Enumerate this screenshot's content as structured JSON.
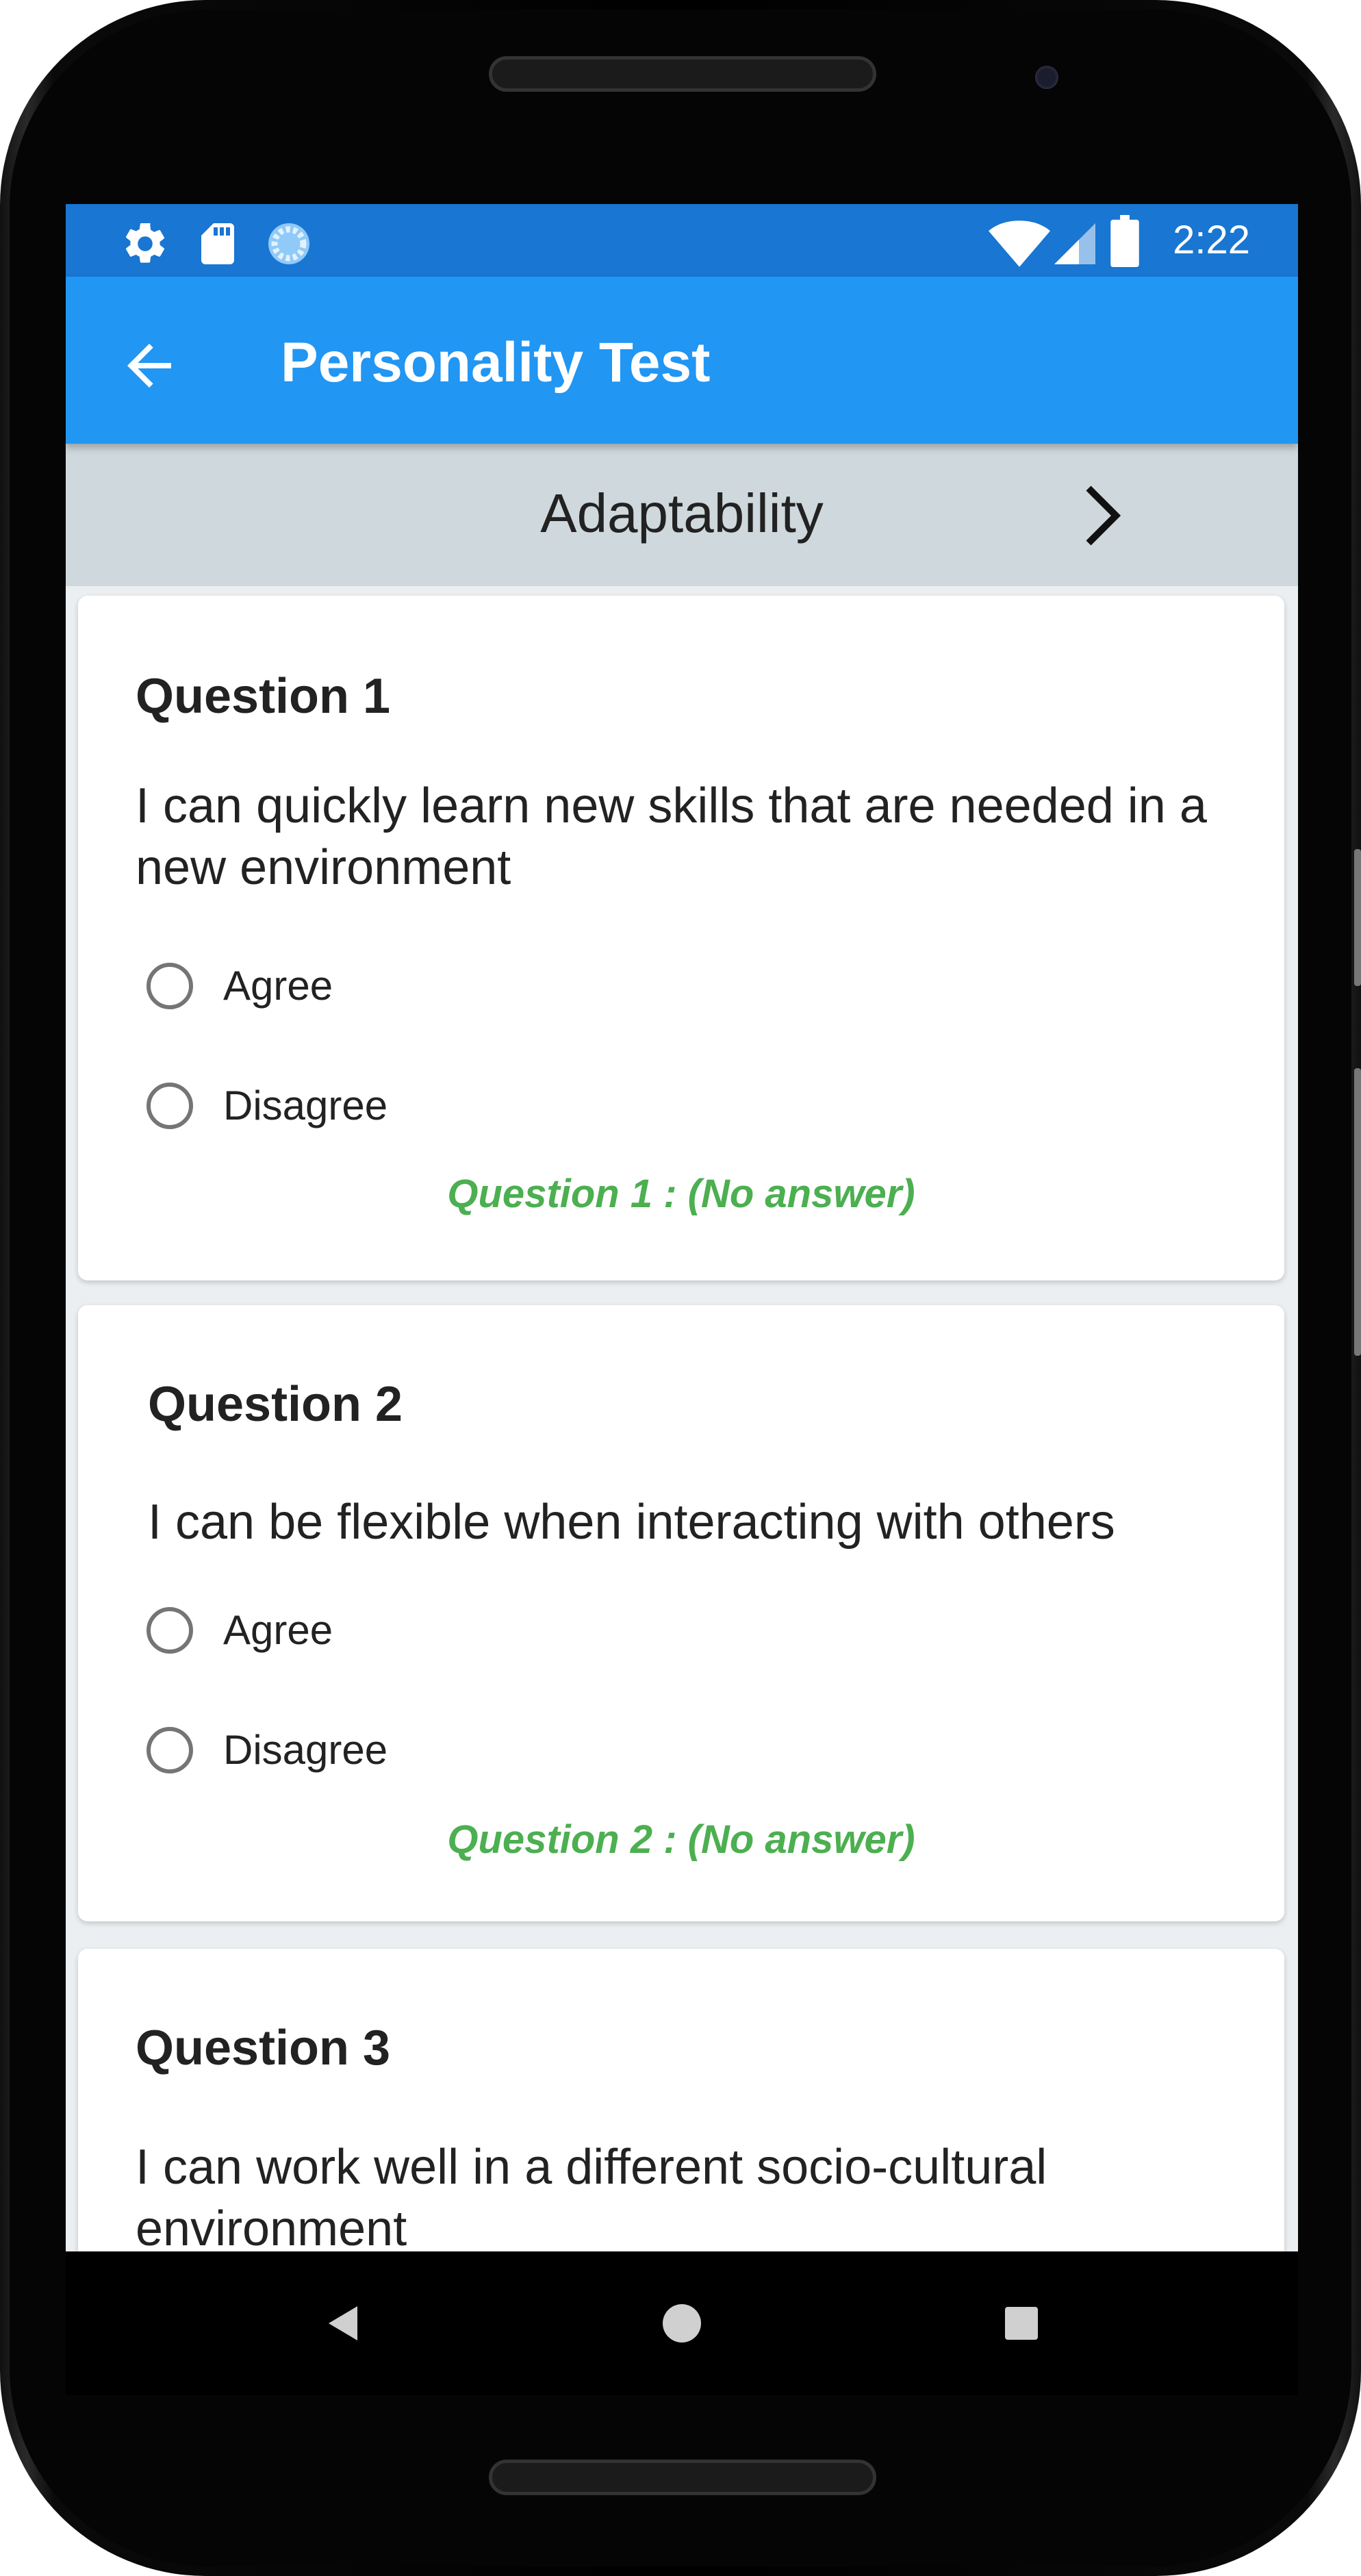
{
  "status_bar": {
    "left_icons": [
      "gear-icon",
      "sd-card-icon",
      "sync-icon"
    ],
    "right_icons": [
      "wifi-icon",
      "signal-icon",
      "battery-icon"
    ],
    "time": "2:22"
  },
  "app_bar": {
    "title": "Personality Test",
    "back_icon": "arrow-left-icon"
  },
  "category": {
    "label": "Adaptability",
    "next_icon": "chevron-right-icon"
  },
  "questions": [
    {
      "title": "Question 1",
      "text": "I can quickly learn new skills that are needed in a new environment",
      "options": [
        "Agree",
        "Disagree"
      ],
      "status": "Question 1 : (No answer)"
    },
    {
      "title": "Question 2",
      "text": "I can be flexible when interacting with others",
      "options": [
        "Agree",
        "Disagree"
      ],
      "status": "Question 2 : (No answer)"
    },
    {
      "title": "Question 3",
      "text": "I can work well in a different socio-cultural environment",
      "options": [],
      "status": ""
    }
  ],
  "nav_bar": {
    "buttons": [
      "back-triangle-icon",
      "home-circle-icon",
      "recents-square-icon"
    ]
  },
  "colors": {
    "status_bar": "#1976d2",
    "app_bar": "#2196f3",
    "category_bar": "#cfd8dc",
    "answer_status": "#4caf50"
  }
}
